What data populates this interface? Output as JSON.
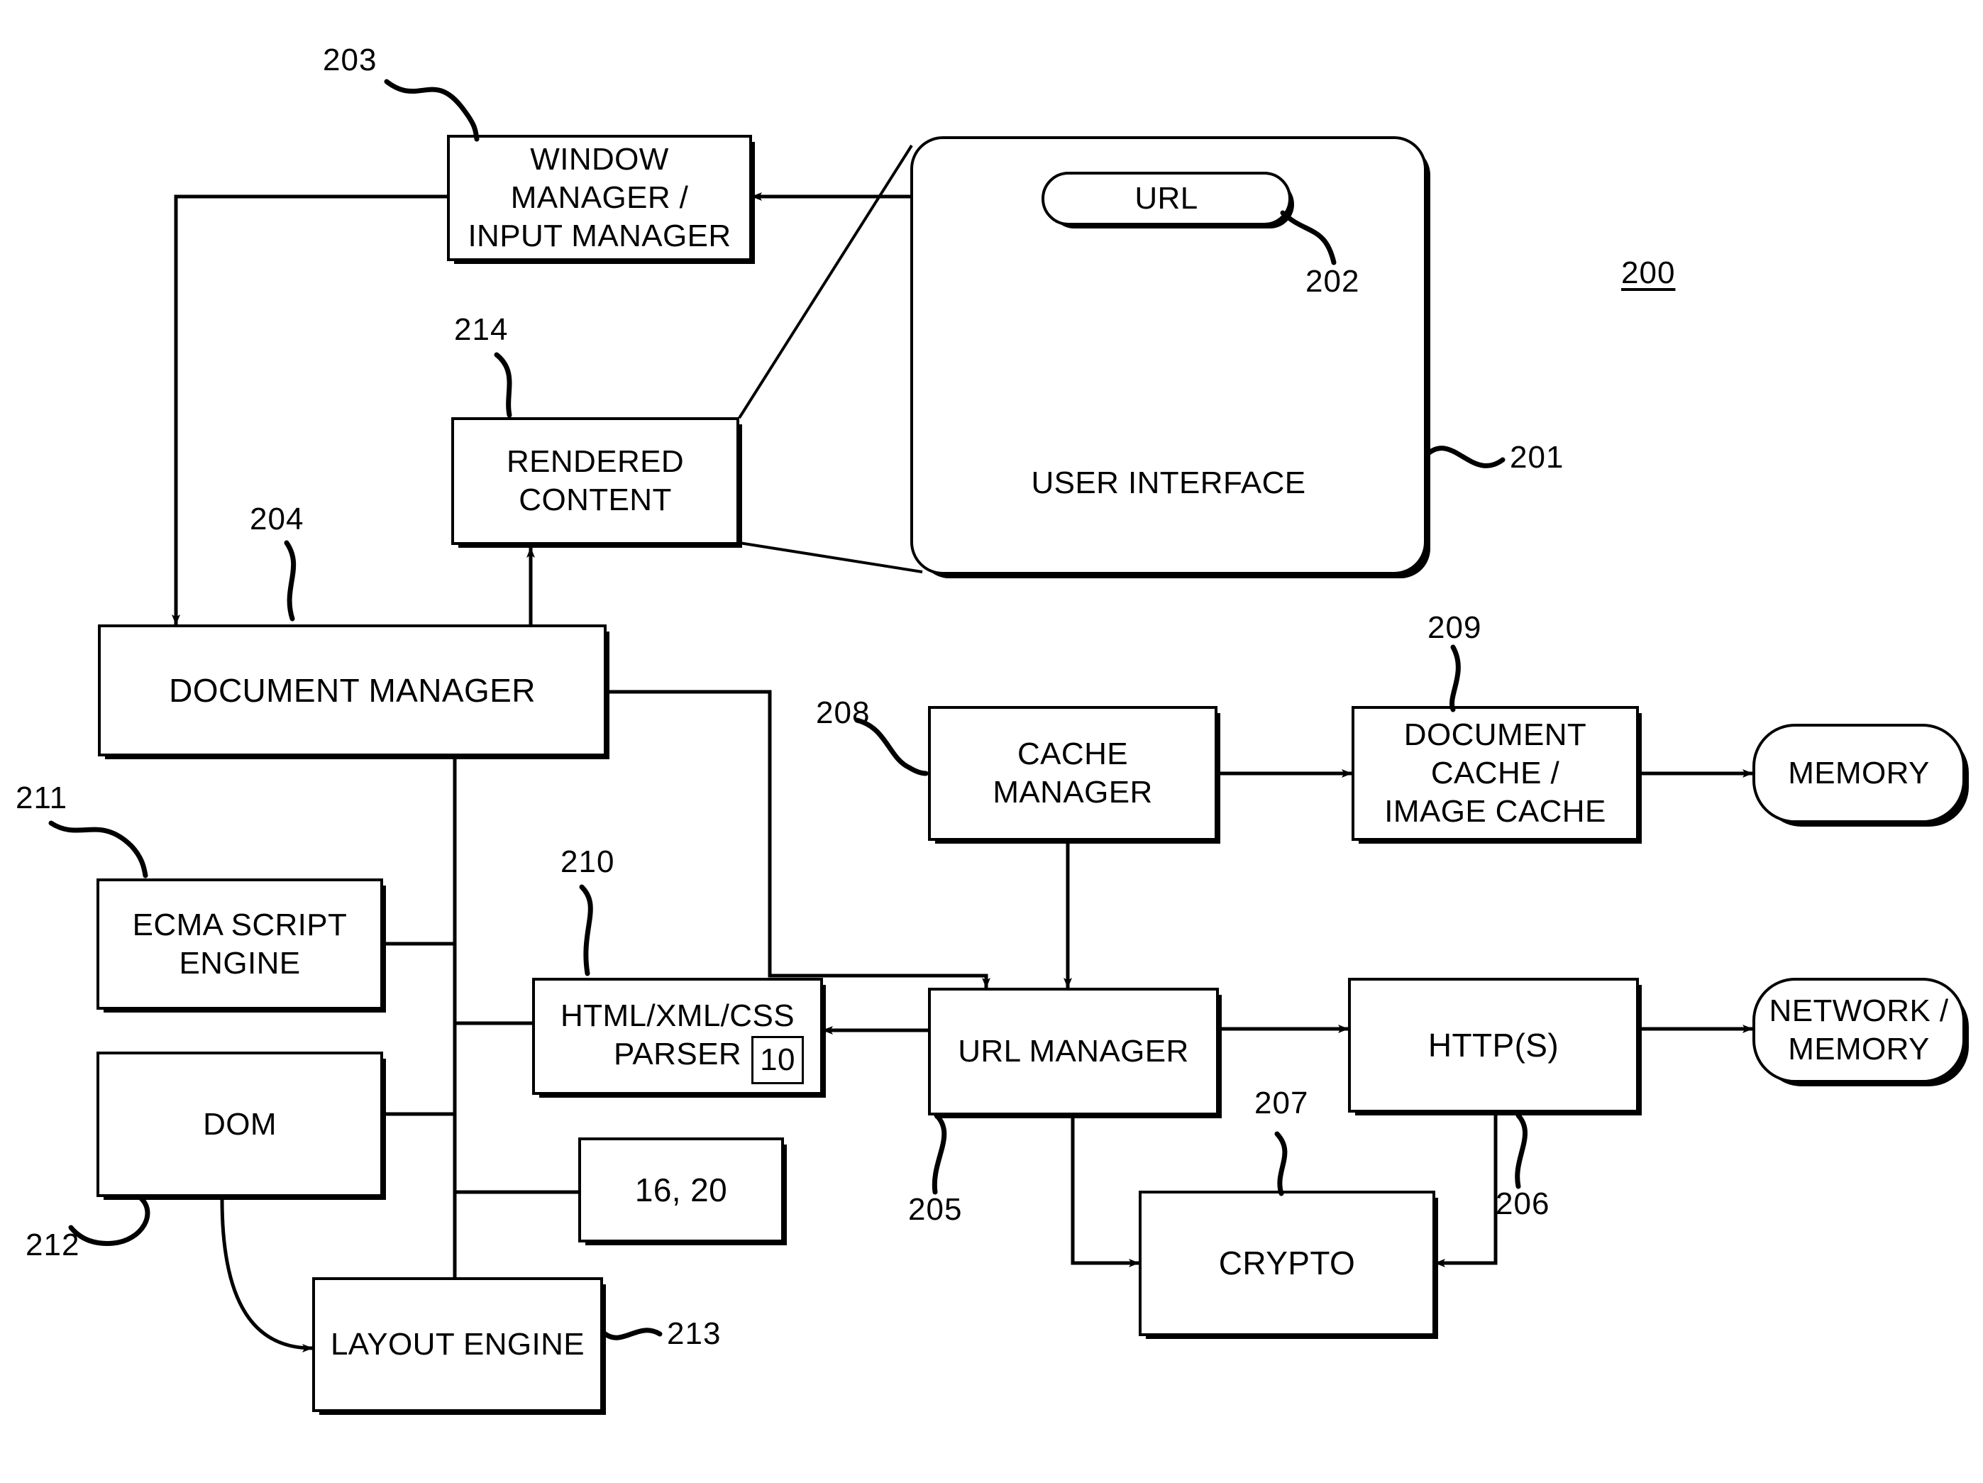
{
  "figure": {
    "figure_ref": "200",
    "blocks": {
      "window_manager": "WINDOW MANAGER /\nINPUT MANAGER",
      "user_interface": "USER INTERFACE",
      "url_pill": "URL",
      "rendered_content": "RENDERED\nCONTENT",
      "document_manager": "DOCUMENT MANAGER",
      "ecma_script_engine": "ECMA SCRIPT\nENGINE",
      "dom": "DOM",
      "layout_engine": "LAYOUT ENGINE",
      "parser": "HTML/XML/CSS\nPARSER",
      "parser_inset": "10",
      "standards_box": "16, 20",
      "cache_manager": "CACHE MANAGER",
      "document_cache": "DOCUMENT CACHE /\nIMAGE CACHE",
      "memory": "MEMORY",
      "url_manager": "URL MANAGER",
      "https": "HTTP(S)",
      "network_memory": "NETWORK /\nMEMORY",
      "crypto": "CRYPTO"
    },
    "reference_numerals": {
      "n200": "200",
      "n201": "201",
      "n202": "202",
      "n203": "203",
      "n204": "204",
      "n205": "205",
      "n206": "206",
      "n207": "207",
      "n208": "208",
      "n209": "209",
      "n210": "210",
      "n211": "211",
      "n212": "212",
      "n213": "213",
      "n214": "214"
    },
    "style": {
      "ink": "#000000",
      "paper": "#ffffff"
    }
  }
}
